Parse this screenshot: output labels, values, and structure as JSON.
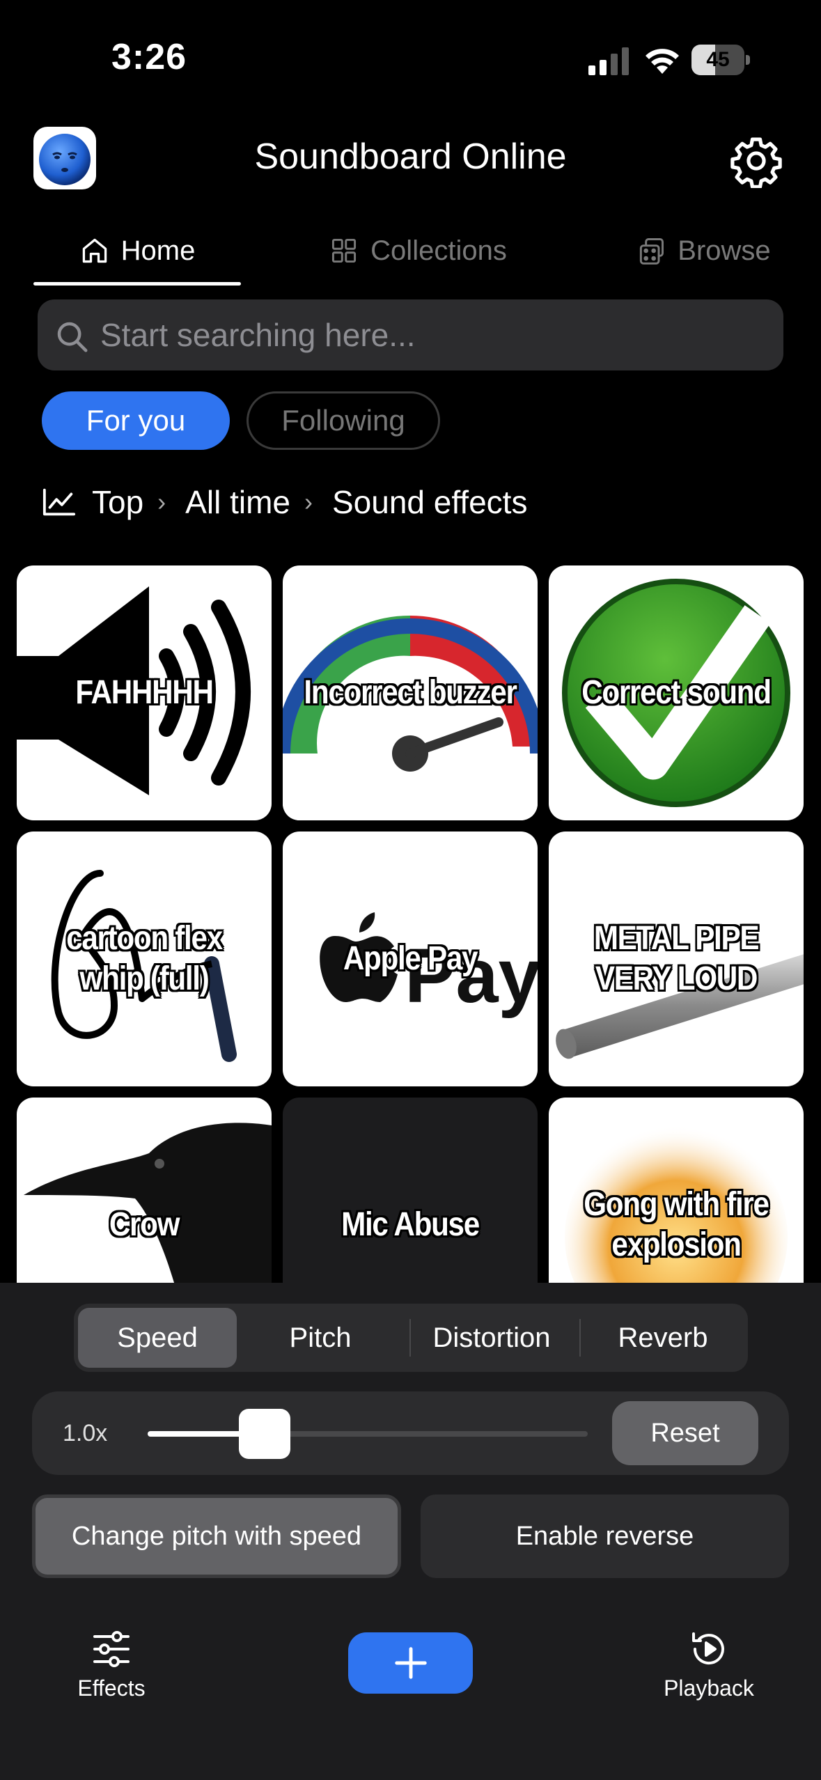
{
  "status_bar": {
    "time": "3:26",
    "battery_level": "45",
    "battery_fraction": 0.45
  },
  "header": {
    "title": "Soundboard Online",
    "logo_icon": "blue-face-icon",
    "settings_icon": "gear-icon"
  },
  "tabs": [
    {
      "label": "Home",
      "icon": "house-icon",
      "active": true
    },
    {
      "label": "Collections",
      "icon": "grid-icon",
      "active": false
    },
    {
      "label": "Browse",
      "icon": "dice-icon",
      "active": false
    }
  ],
  "search": {
    "placeholder": "Start searching here..."
  },
  "feed_filters": [
    {
      "label": "For you",
      "active": true
    },
    {
      "label": "Following",
      "active": false
    }
  ],
  "breadcrumb": {
    "icon": "trend-chart-icon",
    "items": [
      "Top",
      "All time",
      "Sound effects"
    ]
  },
  "sounds": [
    {
      "label": "FAHHHHH",
      "art": "speaker"
    },
    {
      "label": "Incorrect buzzer",
      "art": "gauge"
    },
    {
      "label": "Correct sound",
      "art": "checkmark"
    },
    {
      "label": "cartoon flex whip (full)",
      "art": "whip"
    },
    {
      "label": "Apple Pay",
      "art": "applepay"
    },
    {
      "label": "METAL PIPE VERY LOUD",
      "art": "pipe"
    },
    {
      "label": "Crow",
      "art": "crow"
    },
    {
      "label": "Mic Abuse",
      "art": "dark"
    },
    {
      "label": "Gong with fire explosion",
      "art": "fire"
    }
  ],
  "effects": {
    "segments": [
      "Speed",
      "Pitch",
      "Distortion",
      "Reverb"
    ],
    "active_segment": "Speed",
    "speed_label": "1.0x",
    "speed_fraction": 0.25,
    "reset_label": "Reset",
    "pitch_with_speed_label": "Change pitch with speed",
    "enable_reverse_label": "Enable reverse"
  },
  "bottom_bar": {
    "effects_label": "Effects",
    "playback_label": "Playback",
    "add_icon": "plus-icon"
  },
  "colors": {
    "accent": "#2f74f0",
    "background": "#000000",
    "panel": "#1c1c1e"
  }
}
